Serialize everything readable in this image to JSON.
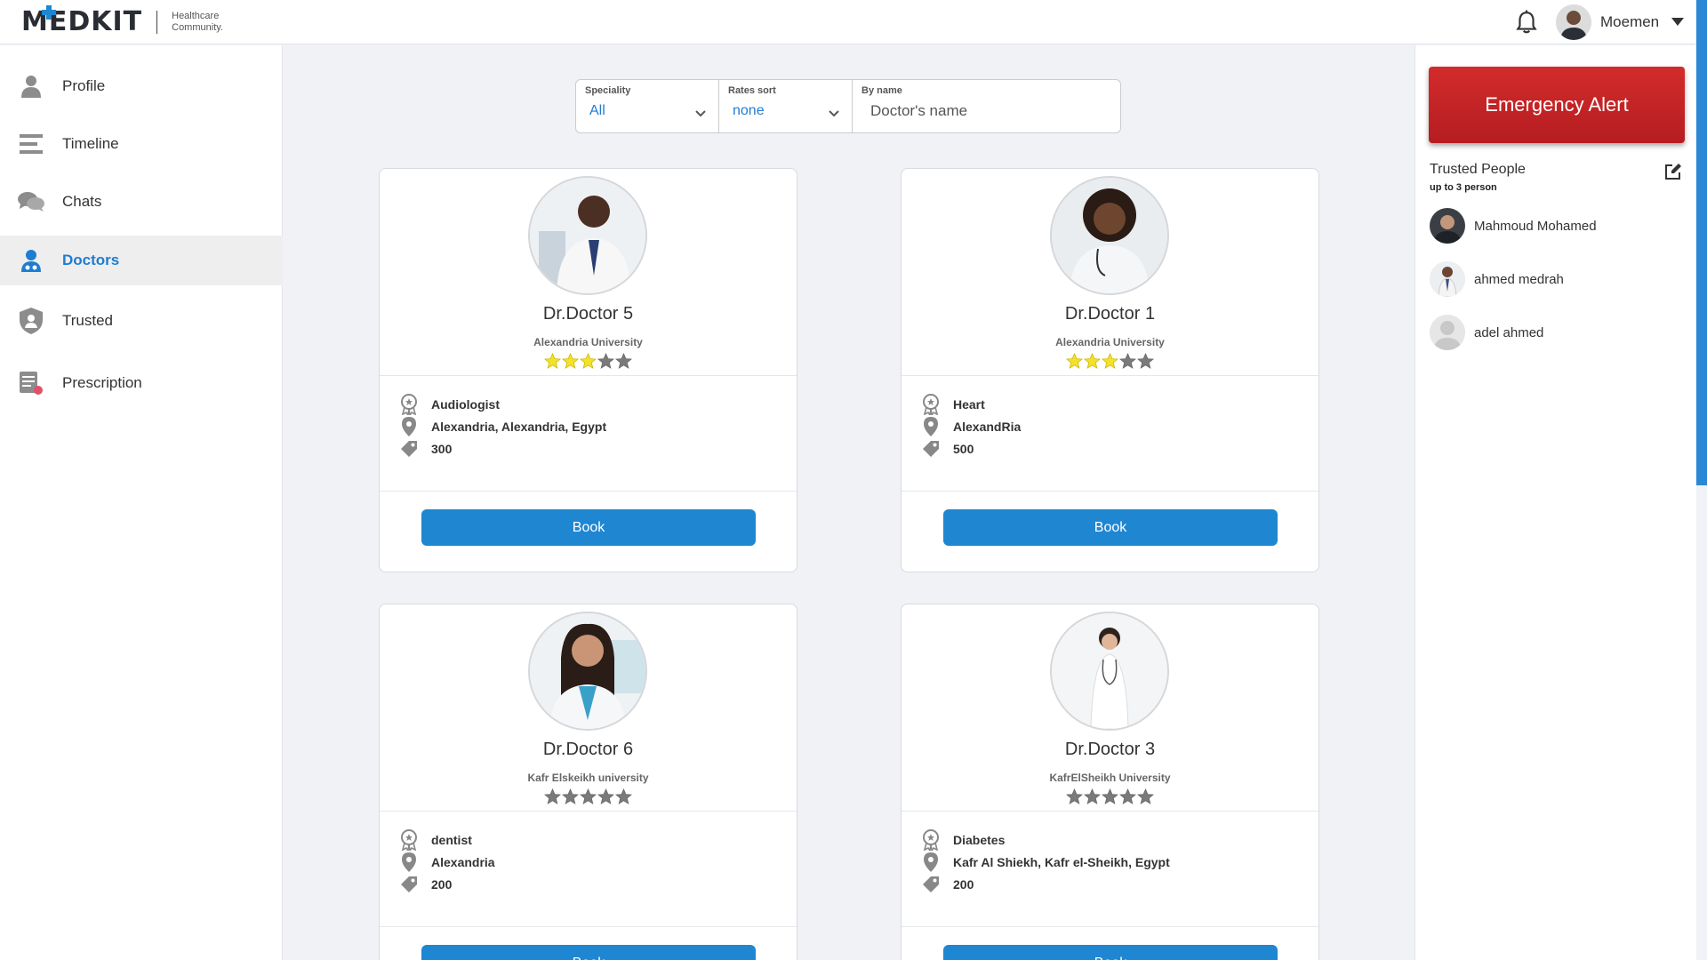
{
  "header": {
    "logo_text": "MEDKIT",
    "logo_tagline_1": "Healthcare",
    "logo_tagline_2": "Community.",
    "user_name": "Moemen"
  },
  "sidebar": {
    "items": [
      {
        "label": "Profile",
        "icon": "user-icon",
        "active": false
      },
      {
        "label": "Timeline",
        "icon": "timeline-icon",
        "active": false
      },
      {
        "label": "Chats",
        "icon": "chats-icon",
        "active": false
      },
      {
        "label": "Doctors",
        "icon": "doctors-icon",
        "active": true
      },
      {
        "label": "Trusted",
        "icon": "shield-icon",
        "active": false
      },
      {
        "label": "Prescription",
        "icon": "prescription-icon",
        "active": false
      }
    ]
  },
  "filter": {
    "speciality_label": "Speciality",
    "speciality_value": "All",
    "rates_label": "Rates sort",
    "rates_value": "none",
    "name_label": "By name",
    "name_placeholder": "Doctor's name"
  },
  "doctors": [
    {
      "name": "Dr.Doctor 5",
      "university": "Alexandria University",
      "rating": 3,
      "speciality": "Audiologist",
      "location": "Alexandria, Alexandria, Egypt",
      "price": "300",
      "book_label": "Book"
    },
    {
      "name": "Dr.Doctor 1",
      "university": "Alexandria University",
      "rating": 3,
      "speciality": "Heart",
      "location": "AlexandRia",
      "price": "500",
      "book_label": "Book"
    },
    {
      "name": "Dr.Doctor 6",
      "university": "Kafr Elskeikh university",
      "rating": 0,
      "speciality": "dentist",
      "location": "Alexandria",
      "price": "200",
      "book_label": "Book"
    },
    {
      "name": "Dr.Doctor 3",
      "university": "KafrElSheikh University",
      "rating": 0,
      "speciality": "Diabetes",
      "location": "Kafr Al Shiekh, Kafr el-Sheikh, Egypt",
      "price": "200",
      "book_label": "Book"
    }
  ],
  "right_panel": {
    "emergency_label": "Emergency Alert",
    "trusted_title": "Trusted People",
    "trusted_subtitle": "up to 3 person",
    "people": [
      {
        "name": "Mahmoud Mohamed"
      },
      {
        "name": "ahmed medrah"
      },
      {
        "name": "adel ahmed"
      }
    ]
  },
  "colors": {
    "accent": "#1f86d1",
    "emergency": "#c82427",
    "star_filled": "#f5e12a",
    "star_empty": "#7a7a7a"
  }
}
